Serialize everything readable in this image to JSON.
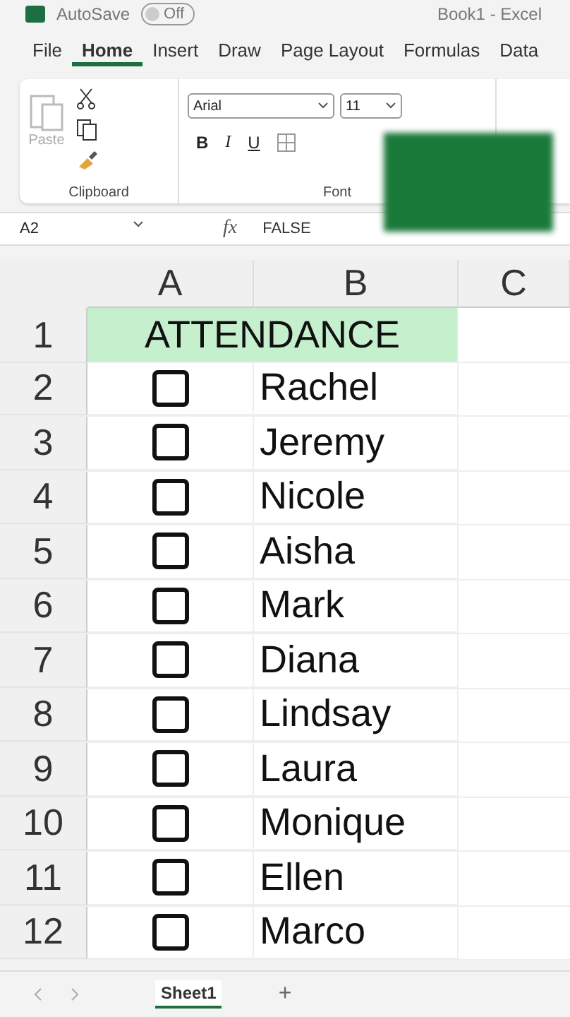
{
  "title_bar": {
    "autosave_label": "AutoSave",
    "autosave_toggle": {
      "label": "Off",
      "on": false
    },
    "document_title": "Book1 - Excel"
  },
  "tabs": [
    {
      "label": "File",
      "selected": false
    },
    {
      "label": "Home",
      "selected": true
    },
    {
      "label": "Insert",
      "selected": false
    },
    {
      "label": "Draw",
      "selected": false
    },
    {
      "label": "Page Layout",
      "selected": false
    },
    {
      "label": "Formulas",
      "selected": false
    },
    {
      "label": "Data",
      "selected": false
    }
  ],
  "ribbon": {
    "clipboard": {
      "paste_label": "Paste",
      "group_label": "Clipboard"
    },
    "font": {
      "font_name": "Arial",
      "font_size": "11",
      "bold": "B",
      "italic": "I",
      "underline": "U",
      "group_label": "Font"
    }
  },
  "formula_bar": {
    "name_box": "A2",
    "fx": "fx",
    "value": "FALSE"
  },
  "sheet": {
    "columns": [
      "A",
      "B",
      "C"
    ],
    "title_row": {
      "number": "1",
      "text": "ATTENDANCE"
    },
    "rows": [
      {
        "number": "2",
        "checked": false,
        "name": "Rachel"
      },
      {
        "number": "3",
        "checked": false,
        "name": "Jeremy"
      },
      {
        "number": "4",
        "checked": false,
        "name": "Nicole"
      },
      {
        "number": "5",
        "checked": false,
        "name": "Aisha"
      },
      {
        "number": "6",
        "checked": false,
        "name": "Mark"
      },
      {
        "number": "7",
        "checked": false,
        "name": "Diana"
      },
      {
        "number": "8",
        "checked": false,
        "name": "Lindsay"
      },
      {
        "number": "9",
        "checked": false,
        "name": "Laura"
      },
      {
        "number": "10",
        "checked": false,
        "name": "Monique"
      },
      {
        "number": "11",
        "checked": false,
        "name": "Ellen"
      },
      {
        "number": "12",
        "checked": false,
        "name": "Marco"
      }
    ]
  },
  "sheet_tabs": [
    {
      "label": "Sheet1",
      "selected": true
    }
  ],
  "add_sheet": "+"
}
